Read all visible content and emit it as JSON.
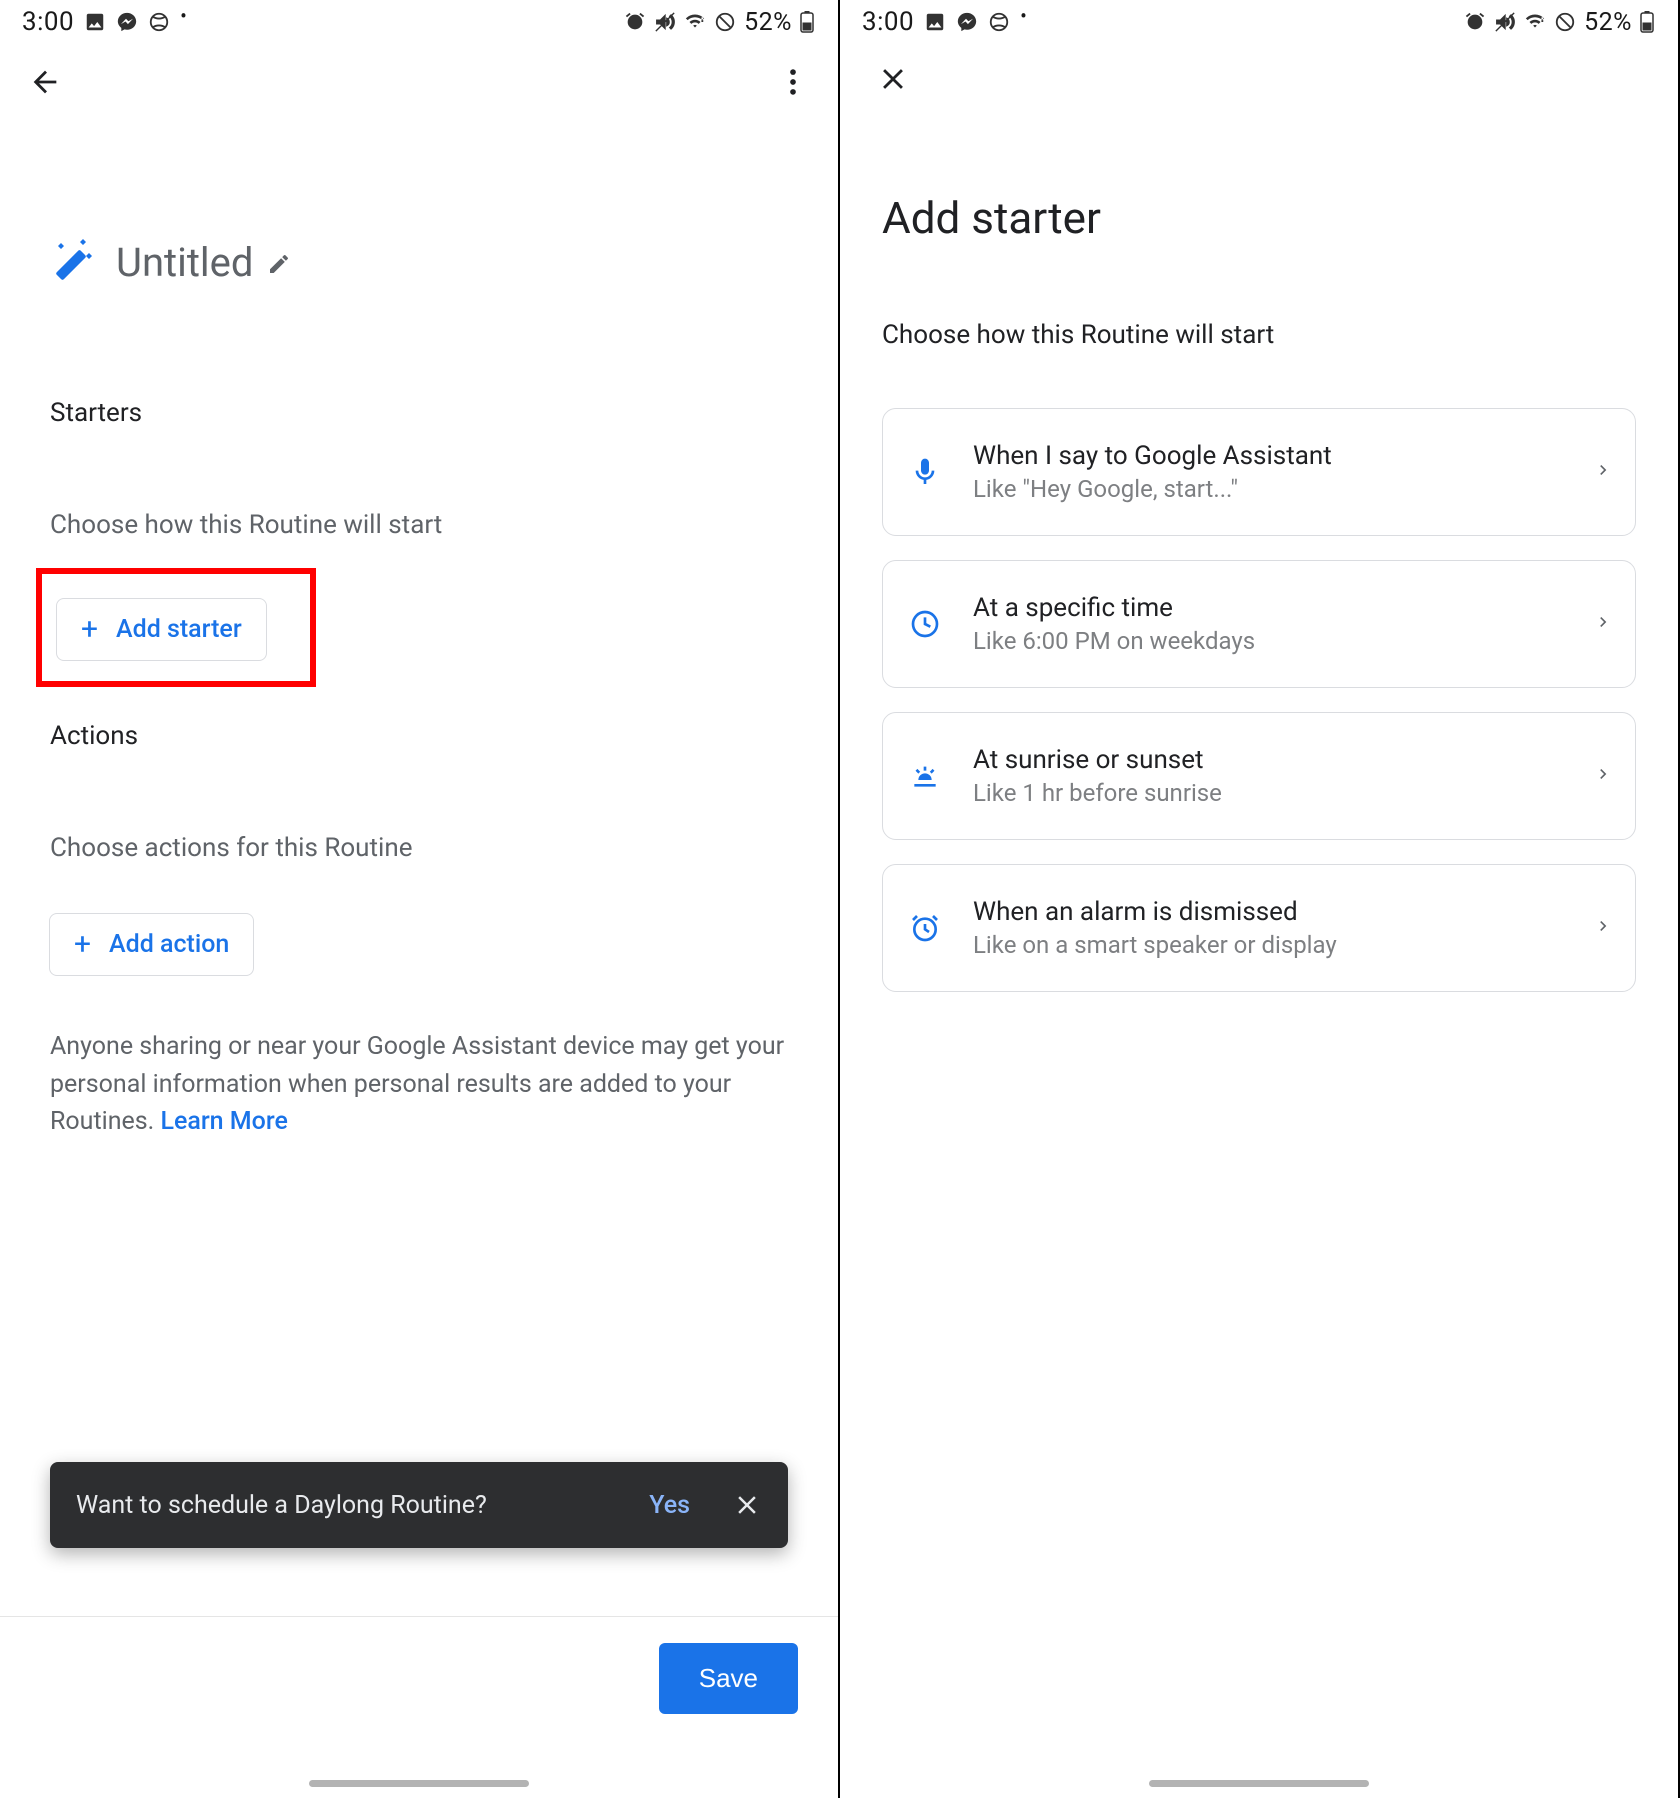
{
  "status": {
    "time": "3:00",
    "battery_pct": "52%"
  },
  "left": {
    "title": "Untitled",
    "starters_label": "Starters",
    "starters_desc": "Choose how this Routine will start",
    "add_starter_label": "Add starter",
    "actions_label": "Actions",
    "actions_desc": "Choose actions for this Routine",
    "add_action_label": "Add action",
    "disclaimer_text": "Anyone sharing or near your Google Assistant device may get your personal information when personal results are added to your Routines. ",
    "disclaimer_link": "Learn More",
    "toast_text": "Want to schedule a Daylong Routine?",
    "toast_yes": "Yes",
    "save_label": "Save"
  },
  "right": {
    "title": "Add starter",
    "subtitle": "Choose how this Routine will start",
    "options": [
      {
        "title": "When I say to Google Assistant",
        "sub": "Like \"Hey Google, start...\""
      },
      {
        "title": "At a specific time",
        "sub": "Like 6:00 PM on weekdays"
      },
      {
        "title": "At sunrise or sunset",
        "sub": "Like 1 hr before sunrise"
      },
      {
        "title": "When an alarm is dismissed",
        "sub": "Like on a smart speaker or display"
      }
    ]
  }
}
